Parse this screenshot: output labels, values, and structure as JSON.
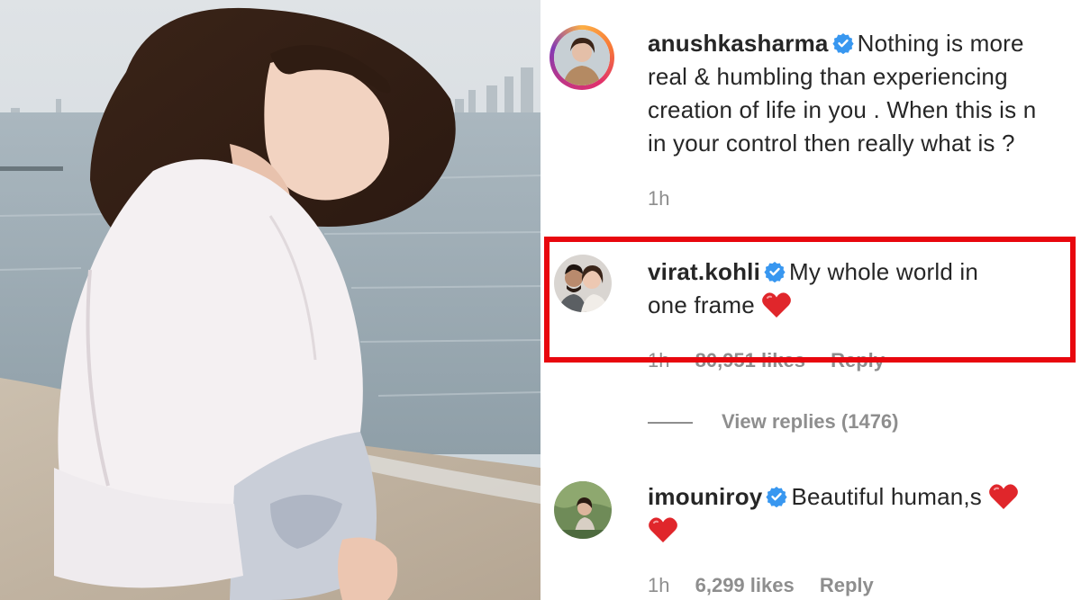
{
  "comments": [
    {
      "username": "anushkasharma",
      "verified": true,
      "lines": [
        "Nothing is more",
        "real & humbling than experiencing",
        "creation of life in you . When this is n",
        "in your control then really what is ?"
      ],
      "time": "1h"
    },
    {
      "username": "virat.kohli",
      "verified": true,
      "lines": [
        "My whole world in",
        "one frame"
      ],
      "time": "1h",
      "likes": "80,951 likes",
      "reply": "Reply",
      "view_replies": "View replies (1476)",
      "highlighted": true
    },
    {
      "username": "imouniroy",
      "verified": true,
      "lines": [
        "Beautiful human,s"
      ],
      "time": "1h",
      "likes": "6,299 likes",
      "reply": "Reply"
    }
  ],
  "colors": {
    "highlight": "#e8070e",
    "verified": "#3897f0",
    "heart": "#e0262b",
    "meta": "#8e8e8e",
    "text": "#262626"
  },
  "icons": [
    "verified-badge-icon",
    "heart-emoji-icon"
  ]
}
